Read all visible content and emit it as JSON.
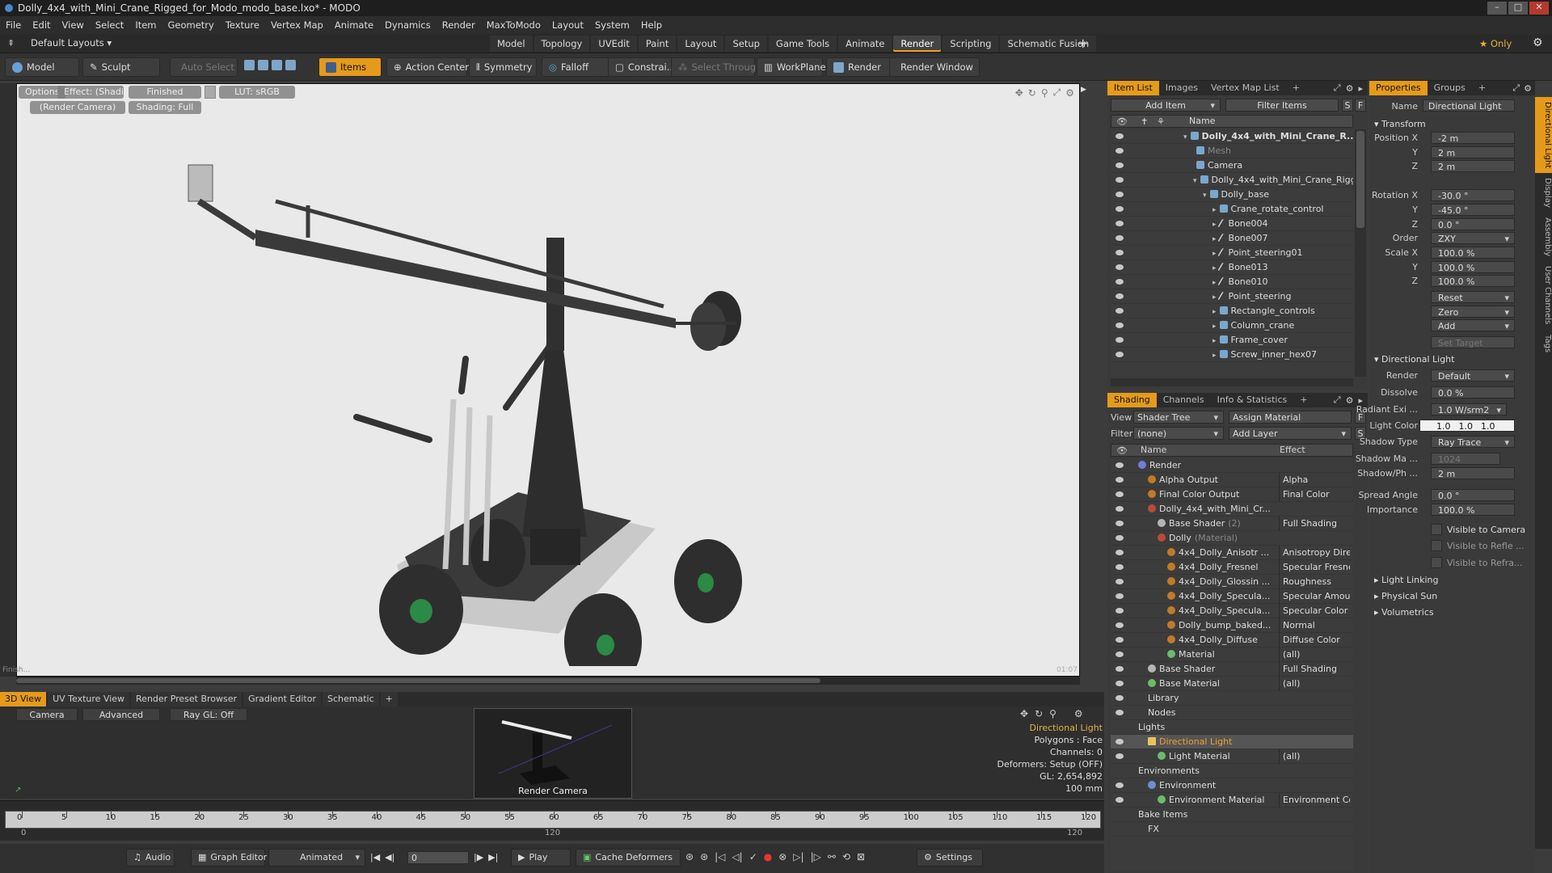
{
  "window": {
    "title": "Dolly_4x4_with_Mini_Crane_Rigged_for_Modo_modo_base.lxo* - MODO",
    "min": "–",
    "max": "□",
    "close": "✕"
  },
  "menu": [
    "File",
    "Edit",
    "View",
    "Select",
    "Item",
    "Geometry",
    "Texture",
    "Vertex Map",
    "Animate",
    "Dynamics",
    "Render",
    "MaxToModo",
    "Layout",
    "System",
    "Help"
  ],
  "layout_selector": "Default Layouts ▾",
  "layout_tabs": [
    {
      "label": "Model",
      "active": false
    },
    {
      "label": "Topology",
      "active": false
    },
    {
      "label": "UVEdit",
      "active": false
    },
    {
      "label": "Paint",
      "active": false
    },
    {
      "label": "Layout",
      "active": false
    },
    {
      "label": "Setup",
      "active": false
    },
    {
      "label": "Game Tools",
      "active": false
    },
    {
      "label": "Animate",
      "active": false
    },
    {
      "label": "Render",
      "active": true
    },
    {
      "label": "Scripting",
      "active": false
    },
    {
      "label": "Schematic Fusion",
      "active": false
    }
  ],
  "layout_add": "+",
  "only_label": "★ Only",
  "toolbar": {
    "model": "Model",
    "sculpt": "Sculpt",
    "auto_select": "Auto Select",
    "items": "Items",
    "action_center": "Action Center",
    "symmetry": "Symmetry",
    "falloff": "Falloff",
    "constraints": "Constrai...",
    "select_through": "Select Through",
    "workplane": "WorkPlane",
    "render": "Render",
    "render_window": "Render Window"
  },
  "viewport": {
    "options": "Options",
    "effect": "Effect: (Shadi...",
    "finished": "Finished",
    "lut": "LUT: sRGB",
    "camera": "(Render Camera)",
    "shading": "Shading: Full",
    "corner_left": "Finish...",
    "corner_right": "01:07"
  },
  "bottom_tabs": [
    {
      "label": "3D View",
      "active": true
    },
    {
      "label": "UV Texture View",
      "active": false
    },
    {
      "label": "Render Preset Browser",
      "active": false
    },
    {
      "label": "Gradient Editor",
      "active": false
    },
    {
      "label": "Schematic",
      "active": false
    },
    {
      "label": "+",
      "active": false
    }
  ],
  "bottom_view": {
    "camera": "Camera",
    "advanced": "Advanced",
    "raygl": "Ray GL: Off",
    "thumb_caption": "Render Camera",
    "info": [
      "Directional Light",
      "Polygons : Face",
      "Channels: 0",
      "Deformers: Setup (OFF)",
      "GL: 2,654,892",
      "100 mm"
    ]
  },
  "timeline": {
    "ticks": [
      0,
      5,
      10,
      15,
      20,
      25,
      30,
      35,
      40,
      45,
      50,
      55,
      60,
      65,
      70,
      75,
      80,
      85,
      90,
      95,
      100,
      105,
      110,
      115,
      120
    ],
    "lower_left": "0",
    "lower_mid": "120",
    "lower_right": "120"
  },
  "transport": {
    "audio": "Audio",
    "graph_editor": "Graph Editor",
    "animated": "Animated",
    "frame": "0",
    "play": "Play",
    "cache_deformers": "Cache Deformers",
    "settings": "Settings"
  },
  "item_list": {
    "tabs": [
      {
        "label": "Item List",
        "active": true
      },
      {
        "label": "Images",
        "active": false
      },
      {
        "label": "Vertex Map List",
        "active": false
      },
      {
        "label": "+",
        "active": false
      }
    ],
    "add_item": "Add Item",
    "filter_items": "Filter Items",
    "col_name": "Name",
    "rows": [
      {
        "label": "Dolly_4x4_with_Mini_Crane_R...",
        "indent": 0,
        "icon": "mesh",
        "bold": true,
        "dim": false
      },
      {
        "label": "Mesh",
        "indent": 1,
        "icon": "mesh",
        "bold": false,
        "dim": true
      },
      {
        "label": "Camera",
        "indent": 1,
        "icon": "mesh",
        "bold": false,
        "dim": false
      },
      {
        "label": "Dolly_4x4_with_Mini_Crane_Rigged",
        "indent": 1,
        "icon": "mesh",
        "bold": false,
        "dim": false
      },
      {
        "label": "Dolly_base",
        "indent": 2,
        "icon": "mesh",
        "bold": false,
        "dim": false
      },
      {
        "label": "Crane_rotate_control",
        "indent": 3,
        "icon": "mesh",
        "bold": false,
        "dim": false
      },
      {
        "label": "Bone004",
        "indent": 3,
        "icon": "bone",
        "bold": false,
        "dim": false
      },
      {
        "label": "Bone007",
        "indent": 3,
        "icon": "bone",
        "bold": false,
        "dim": false
      },
      {
        "label": "Point_steering01",
        "indent": 3,
        "icon": "bone",
        "bold": false,
        "dim": false
      },
      {
        "label": "Bone013",
        "indent": 3,
        "icon": "bone",
        "bold": false,
        "dim": false
      },
      {
        "label": "Bone010",
        "indent": 3,
        "icon": "bone",
        "bold": false,
        "dim": false
      },
      {
        "label": "Point_steering",
        "indent": 3,
        "icon": "bone",
        "bold": false,
        "dim": false
      },
      {
        "label": "Rectangle_controls",
        "indent": 3,
        "icon": "mesh",
        "bold": false,
        "dim": false
      },
      {
        "label": "Column_crane",
        "indent": 3,
        "icon": "mesh",
        "bold": false,
        "dim": false
      },
      {
        "label": "Frame_cover",
        "indent": 3,
        "icon": "mesh",
        "bold": false,
        "dim": false
      },
      {
        "label": "Screw_inner_hex07",
        "indent": 3,
        "icon": "mesh",
        "bold": false,
        "dim": false
      }
    ]
  },
  "shading": {
    "tabs": [
      {
        "label": "Shading",
        "active": true
      },
      {
        "label": "Channels",
        "active": false
      },
      {
        "label": "Info & Statistics",
        "active": false
      },
      {
        "label": "+",
        "active": false
      }
    ],
    "view_label": "View",
    "view_value": "Shader Tree",
    "assign_material": "Assign Material",
    "filter_label": "Filter",
    "filter_value": "(none)",
    "add_layer": "Add Layer",
    "col_name": "Name",
    "col_effect": "Effect",
    "rows": [
      {
        "label": "Render",
        "effect": "",
        "indent": 0,
        "icon": "render",
        "sub": ""
      },
      {
        "label": "Alpha Output",
        "effect": "Alpha",
        "indent": 1,
        "icon": "tex",
        "sub": ""
      },
      {
        "label": "Final Color Output",
        "effect": "Final Color",
        "indent": 1,
        "icon": "tex",
        "sub": ""
      },
      {
        "label": "Dolly_4x4_with_Mini_Cr...",
        "effect": "",
        "indent": 1,
        "icon": "red",
        "sub": ""
      },
      {
        "label": "Base Shader",
        "effect": "Full Shading",
        "indent": 2,
        "icon": "ball",
        "sub": "(2)"
      },
      {
        "label": "Dolly",
        "effect": "",
        "indent": 2,
        "icon": "red",
        "sub": "(Material)"
      },
      {
        "label": "4x4_Dolly_Anisotr ...",
        "effect": "Anisotropy Dire...",
        "indent": 3,
        "icon": "tex",
        "sub": ""
      },
      {
        "label": "4x4_Dolly_Fresnel",
        "effect": "Specular Fresnel",
        "indent": 3,
        "icon": "tex",
        "sub": ""
      },
      {
        "label": "4x4_Dolly_Glossin ...",
        "effect": "Roughness",
        "indent": 3,
        "icon": "tex",
        "sub": ""
      },
      {
        "label": "4x4_Dolly_Specula...",
        "effect": "Specular Amount",
        "indent": 3,
        "icon": "tex",
        "sub": ""
      },
      {
        "label": "4x4_Dolly_Specula...",
        "effect": "Specular Color",
        "indent": 3,
        "icon": "tex",
        "sub": ""
      },
      {
        "label": "Dolly_bump_baked...",
        "effect": "Normal",
        "indent": 3,
        "icon": "tex",
        "sub": ""
      },
      {
        "label": "4x4_Dolly_Diffuse",
        "effect": "Diffuse Color",
        "indent": 3,
        "icon": "tex",
        "sub": ""
      },
      {
        "label": "Material",
        "effect": "(all)",
        "indent": 3,
        "icon": "mat",
        "sub": ""
      },
      {
        "label": "Base Shader",
        "effect": "Full Shading",
        "indent": 1,
        "icon": "ball",
        "sub": ""
      },
      {
        "label": "Base Material",
        "effect": "(all)",
        "indent": 1,
        "icon": "mat",
        "sub": ""
      },
      {
        "label": "Library",
        "effect": "",
        "indent": 1,
        "icon": "none",
        "sub": ""
      },
      {
        "label": "Nodes",
        "effect": "",
        "indent": 1,
        "icon": "none",
        "sub": ""
      },
      {
        "label": "Lights",
        "effect": "",
        "indent": 0,
        "icon": "none",
        "sub": ""
      },
      {
        "label": "Directional Light",
        "effect": "",
        "indent": 1,
        "icon": "dir",
        "sub": "",
        "selected": true
      },
      {
        "label": "Light Material",
        "effect": "(all)",
        "indent": 2,
        "icon": "mat",
        "sub": ""
      },
      {
        "label": "Environments",
        "effect": "",
        "indent": 0,
        "icon": "none",
        "sub": ""
      },
      {
        "label": "Environment",
        "effect": "",
        "indent": 1,
        "icon": "env",
        "sub": ""
      },
      {
        "label": "Environment Material",
        "effect": "Environment Co...",
        "indent": 2,
        "icon": "mat",
        "sub": ""
      },
      {
        "label": "Bake Items",
        "effect": "",
        "indent": 0,
        "icon": "none",
        "sub": ""
      },
      {
        "label": "FX",
        "effect": "",
        "indent": 1,
        "icon": "none",
        "sub": ""
      }
    ]
  },
  "properties": {
    "tabs": [
      {
        "label": "Properties",
        "active": true
      },
      {
        "label": "Groups",
        "active": false
      },
      {
        "label": "+",
        "active": false
      }
    ],
    "name_label": "Name",
    "name_value": "Directional Light",
    "transform_header": "Transform",
    "position": [
      {
        "l": "Position X",
        "v": "-2 m"
      },
      {
        "l": "Y",
        "v": "2 m"
      },
      {
        "l": "Z",
        "v": "2 m"
      }
    ],
    "rotation": [
      {
        "l": "Rotation X",
        "v": "-30.0 °"
      },
      {
        "l": "Y",
        "v": "-45.0 °"
      },
      {
        "l": "Z",
        "v": "0.0 °"
      }
    ],
    "order": {
      "l": "Order",
      "v": "ZXY"
    },
    "scale": [
      {
        "l": "Scale X",
        "v": "100.0 %"
      },
      {
        "l": "Y",
        "v": "100.0 %"
      },
      {
        "l": "Z",
        "v": "100.0 %"
      }
    ],
    "reset": "Reset",
    "zero": "Zero",
    "add": "Add",
    "set_target": "Set Target",
    "dl_header": "Directional Light",
    "render": {
      "l": "Render",
      "v": "Default"
    },
    "dissolve": {
      "l": "Dissolve",
      "v": "0.0 %"
    },
    "radiant": {
      "l": "Radiant Exi ...",
      "v": "1.0 W/srm2"
    },
    "light_color": {
      "l": "Light Color",
      "r": "1.0",
      "g": "1.0",
      "b": "1.0"
    },
    "shadow_type": {
      "l": "Shadow Type",
      "v": "Ray Trace"
    },
    "shadow_map": {
      "l": "Shadow Ma ...",
      "v": "1024"
    },
    "shadow_ph": {
      "l": "Shadow/Ph ...",
      "v": "2 m"
    },
    "spread": {
      "l": "Spread Angle",
      "v": "0.0 °"
    },
    "importance": {
      "l": "Importance",
      "v": "100.0 %"
    },
    "vis_camera": "Visible to Camera",
    "vis_refl": "Visible to Refle ...",
    "vis_refr": "Visible to Refra...",
    "sections": [
      "Light Linking",
      "Physical Sun",
      "Volumetrics"
    ]
  },
  "side_tabs": [
    "Directional Light",
    "Display",
    "Assembly",
    "User Channels",
    "Tags"
  ]
}
